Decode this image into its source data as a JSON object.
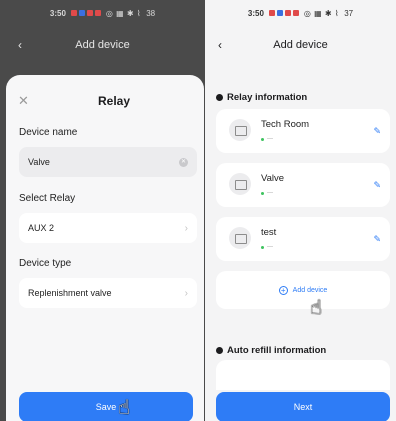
{
  "left": {
    "status_time": "3:50",
    "status_battery": "38",
    "header_title": "Add device",
    "sheet": {
      "title": "Relay",
      "device_name_label": "Device name",
      "device_name_value": "Valve",
      "select_relay_label": "Select Relay",
      "select_relay_value": "AUX 2",
      "device_type_label": "Device type",
      "device_type_value": "Replenishment valve",
      "save_label": "Save"
    }
  },
  "right": {
    "status_time": "3:50",
    "status_battery": "37",
    "header_title": "Add device",
    "relay_section_title": "Relay information",
    "relays": [
      {
        "name": "Tech Room",
        "status": "---"
      },
      {
        "name": "Valve",
        "status": "---"
      },
      {
        "name": "test",
        "status": "---"
      }
    ],
    "add_device_label": "Add device",
    "auto_refill_title": "Auto refill information",
    "next_label": "Next"
  },
  "colors": {
    "accent": "#2e7cf6",
    "status_online": "#3ec35f"
  }
}
